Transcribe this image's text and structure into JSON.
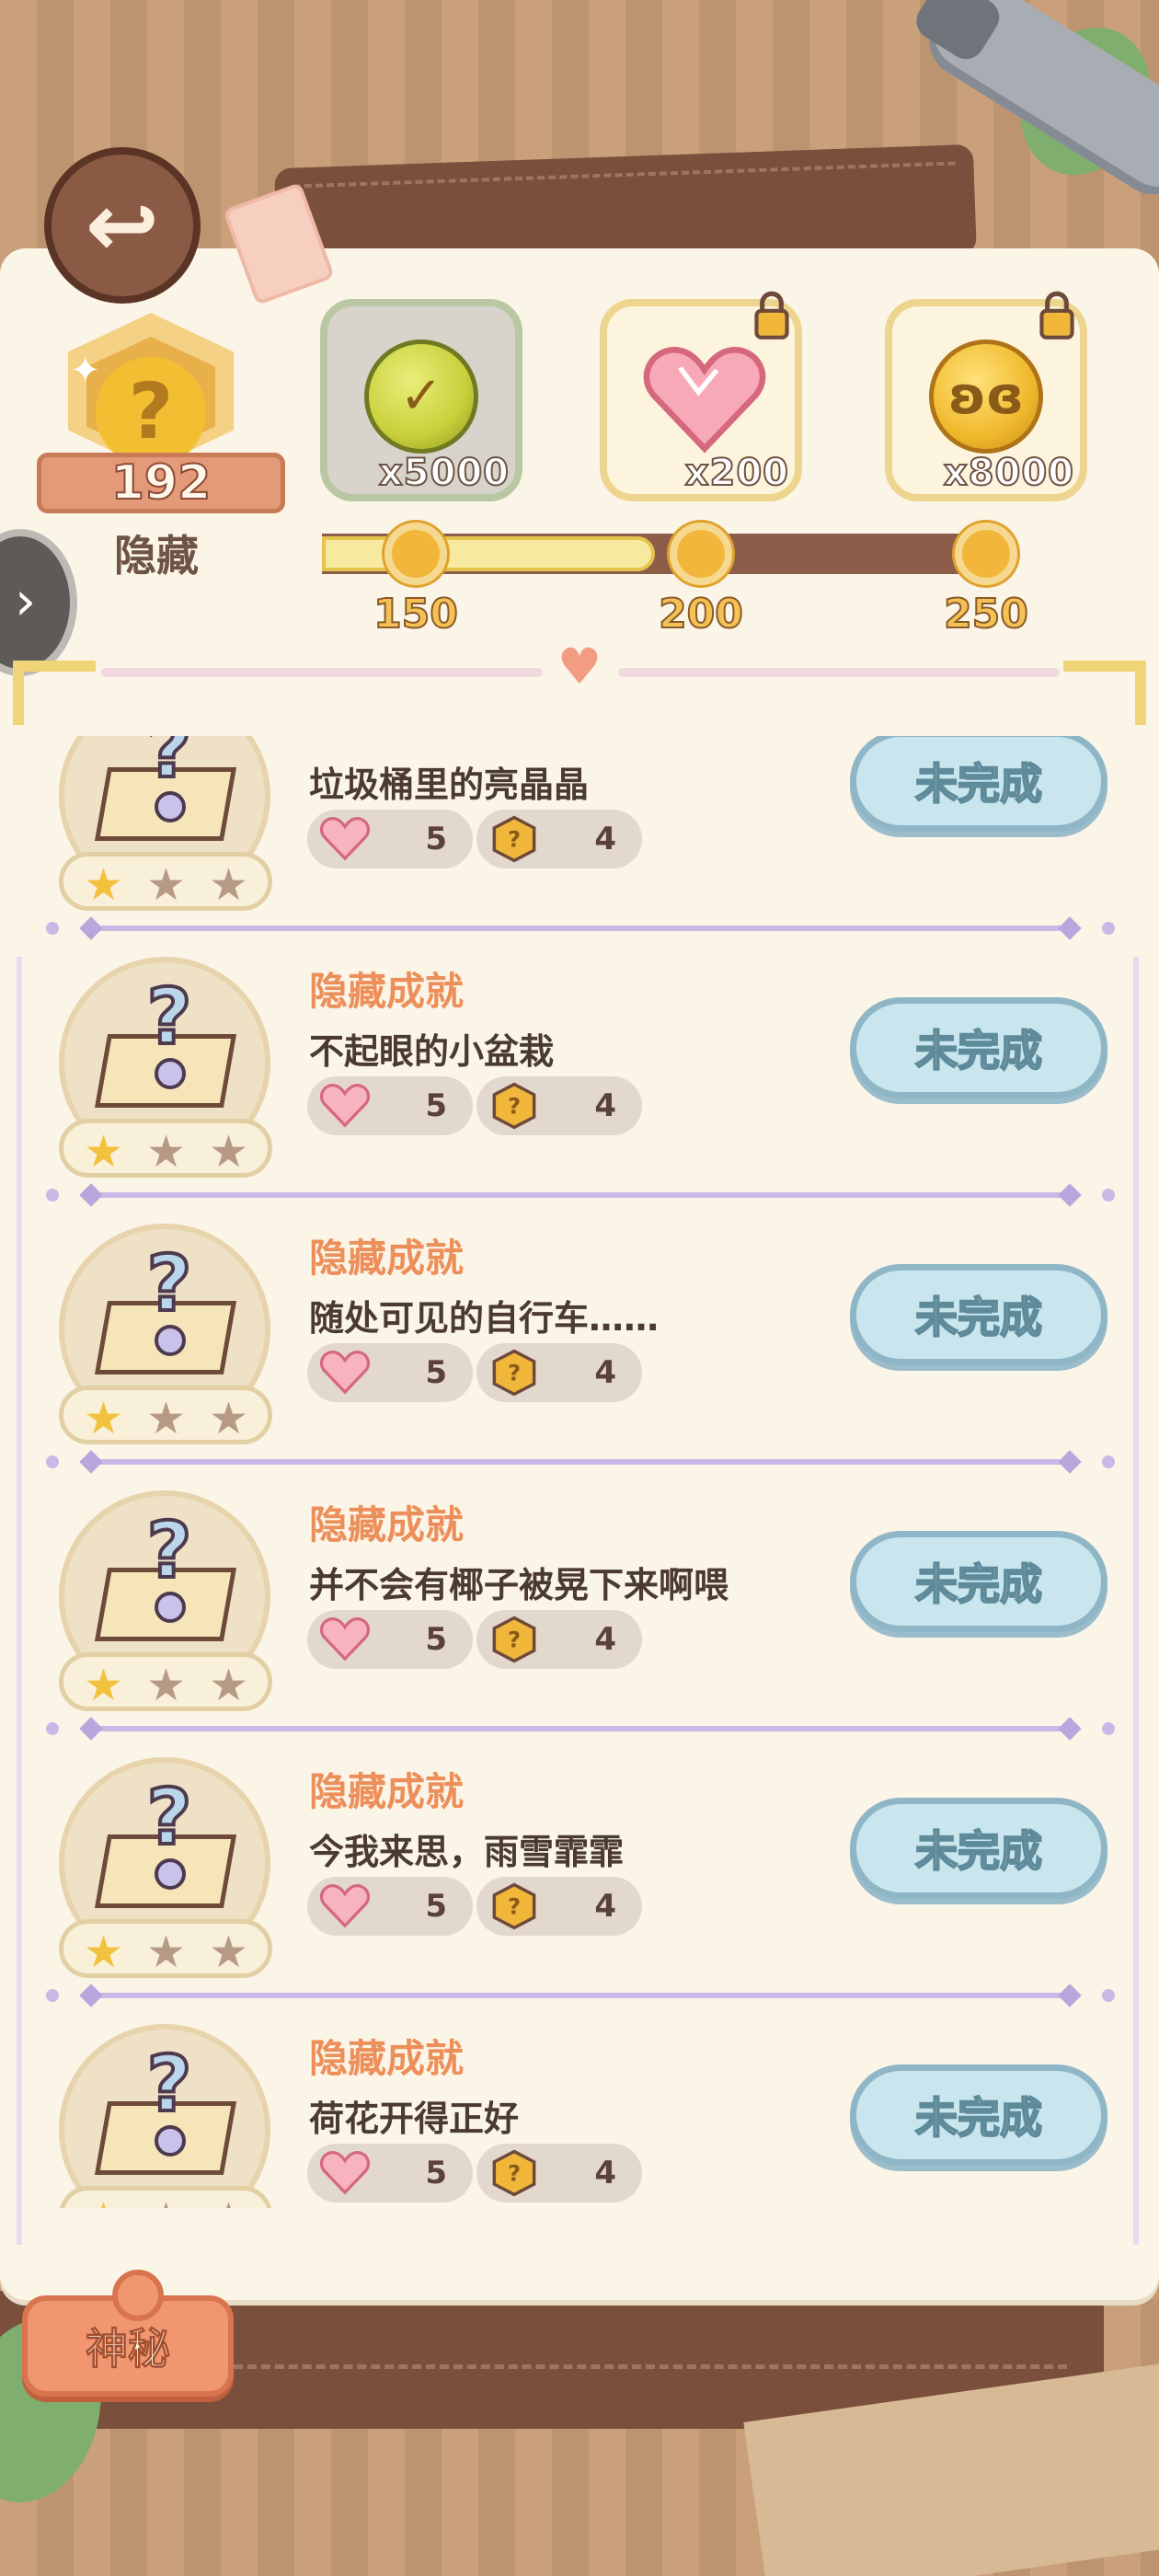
{
  "header": {
    "back_icon": "back-arrow-icon",
    "badge_count": "192",
    "badge_label": "隐藏",
    "side_tab_icon": "chevron-right-icon"
  },
  "rewards": [
    {
      "icon": "check-coin-icon",
      "amount": "x5000",
      "state": "claimed"
    },
    {
      "icon": "heart-gem-icon",
      "amount": "x200",
      "state": "locked"
    },
    {
      "icon": "bunny-coin-icon",
      "amount": "x8000",
      "state": "locked"
    }
  ],
  "progress": {
    "milestones": [
      "150",
      "200",
      "250"
    ],
    "current": 192
  },
  "achievements": [
    {
      "title": "",
      "desc": "垃圾桶里的亮晶晶",
      "heart": "5",
      "coin": "4",
      "button": "未完成"
    },
    {
      "title": "隐藏成就",
      "desc": "不起眼的小盆栽",
      "heart": "5",
      "coin": "4",
      "button": "未完成"
    },
    {
      "title": "隐藏成就",
      "desc": "随处可见的自行车……",
      "heart": "5",
      "coin": "4",
      "button": "未完成"
    },
    {
      "title": "隐藏成就",
      "desc": "并不会有椰子被晃下来啊喂",
      "heart": "5",
      "coin": "4",
      "button": "未完成"
    },
    {
      "title": "隐藏成就",
      "desc": "今我来思，雨雪霏霏",
      "heart": "5",
      "coin": "4",
      "button": "未完成"
    },
    {
      "title": "隐藏成就",
      "desc": "荷花开得正好",
      "heart": "5",
      "coin": "4",
      "button": "未完成"
    }
  ],
  "footer": {
    "tag_label": "神秘"
  },
  "colors": {
    "accent_title": "#ec8f5a",
    "button_blue": "#c9e6ee",
    "tag_orange": "#f09670",
    "wood_dark": "#7a4f3c"
  }
}
